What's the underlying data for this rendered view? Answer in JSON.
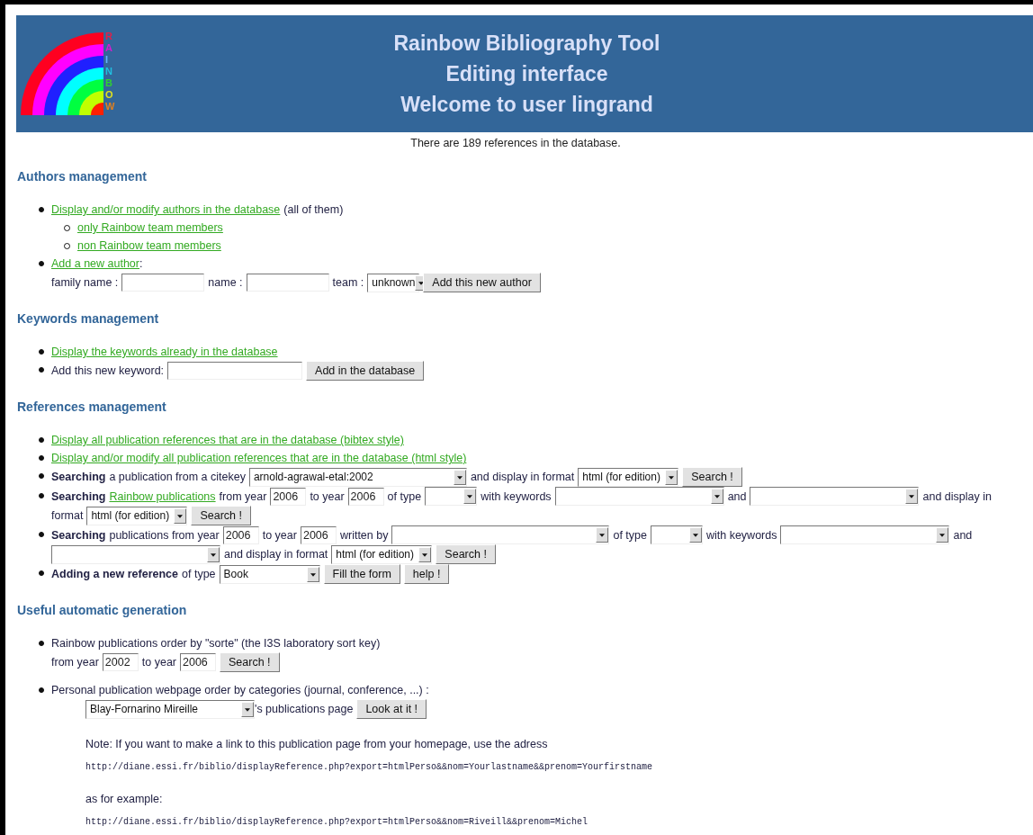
{
  "header": {
    "logo_letters": [
      {
        "text": "R",
        "color": "#e0204a"
      },
      {
        "text": "A",
        "color": "#d020d0"
      },
      {
        "text": "I",
        "color": "#66b3ff"
      },
      {
        "text": "N",
        "color": "#20c0e0"
      },
      {
        "text": "B",
        "color": "#30d030"
      },
      {
        "text": "O",
        "color": "#e0e020"
      },
      {
        "text": "W",
        "color": "#e08020"
      }
    ],
    "titles": [
      "Rainbow Bibliography Tool",
      "Editing interface",
      "Welcome to user lingrand"
    ]
  },
  "count_note": "There are 189 references in the database.",
  "sections": [
    {
      "title": "Authors management",
      "items": [
        {
          "parts": [
            {
              "kind": "link",
              "text": "Display and/or modify authors in the database"
            },
            {
              "kind": "text",
              "text": "(all of them)"
            }
          ],
          "children": [
            {
              "parts": [
                {
                  "kind": "link",
                  "text": "only Rainbow team members"
                }
              ]
            },
            {
              "parts": [
                {
                  "kind": "link",
                  "text": "non Rainbow team members"
                }
              ]
            }
          ]
        },
        {
          "parts": [
            {
              "kind": "link",
              "text": "Add a new author"
            },
            {
              "kind": "suffix",
              "text": ":"
            },
            {
              "kind": "break"
            },
            {
              "kind": "text",
              "text": "family name :"
            },
            {
              "kind": "namefield"
            },
            {
              "kind": "text",
              "text": "name :"
            },
            {
              "kind": "namefield"
            },
            {
              "kind": "text",
              "text": "team :"
            },
            {
              "kind": "typeselect",
              "value": "unknown"
            },
            {
              "kind": "button",
              "text": "Add this new author"
            }
          ]
        }
      ]
    },
    {
      "title": "Keywords management",
      "items": [
        {
          "parts": [
            {
              "kind": "link",
              "text": "Display the keywords already in the database"
            }
          ]
        },
        {
          "parts": [
            {
              "kind": "text",
              "text": "Add this new keyword:"
            },
            {
              "kind": "keywordfield"
            },
            {
              "kind": "button",
              "text": "Add in the database"
            }
          ]
        }
      ]
    },
    {
      "title": "References management",
      "items": [
        {
          "parts": [
            {
              "kind": "link",
              "text": "Display all publication references that are in the database (bibtex style)"
            }
          ]
        },
        {
          "parts": [
            {
              "kind": "link",
              "text": "Display and/or modify all publication references that are in the database (html style)"
            }
          ]
        },
        {
          "parts": [
            {
              "kind": "bold",
              "text": "Searching"
            },
            {
              "kind": "text",
              "text": "a publication from a citekey"
            },
            {
              "kind": "citekeyselect",
              "value": "arnold-agrawal-etal:2002"
            },
            {
              "kind": "text",
              "text": "and display in format"
            },
            {
              "kind": "formatselect",
              "value": "html (for edition)"
            },
            {
              "kind": "button",
              "text": "Search !"
            }
          ]
        },
        {
          "parts": [
            {
              "kind": "bold",
              "text": "Searching"
            },
            {
              "kind": "link",
              "text": "Rainbow publications"
            },
            {
              "kind": "text",
              "text": "from year"
            },
            {
              "kind": "yearfield",
              "value": "2006"
            },
            {
              "kind": "text",
              "text": "to year"
            },
            {
              "kind": "yearfield",
              "value": "2006"
            },
            {
              "kind": "text",
              "text": "of type"
            },
            {
              "kind": "typeselect"
            },
            {
              "kind": "text",
              "text": "with keywords"
            },
            {
              "kind": "keywordselect"
            },
            {
              "kind": "text",
              "text": "and"
            },
            {
              "kind": "keywordselect"
            },
            {
              "kind": "text",
              "text": "and display in"
            },
            {
              "kind": "break"
            },
            {
              "kind": "text",
              "text": "format"
            },
            {
              "kind": "formatselect",
              "value": "html (for edition)"
            },
            {
              "kind": "button",
              "text": "Search !"
            }
          ]
        },
        {
          "parts": [
            {
              "kind": "bold",
              "text": "Searching"
            },
            {
              "kind": "text",
              "text": "publications from year"
            },
            {
              "kind": "yearfield",
              "value": "2006"
            },
            {
              "kind": "text",
              "text": "to year"
            },
            {
              "kind": "yearfield",
              "value": "2006"
            },
            {
              "kind": "text",
              "text": "written by"
            },
            {
              "kind": "citekeyselect"
            },
            {
              "kind": "text",
              "text": "of type"
            },
            {
              "kind": "typeselect"
            },
            {
              "kind": "text",
              "text": "with keywords"
            },
            {
              "kind": "keywordselect"
            },
            {
              "kind": "text",
              "text": "and"
            },
            {
              "kind": "break"
            },
            {
              "kind": "keywordselect"
            },
            {
              "kind": "text",
              "text": "and display in format"
            },
            {
              "kind": "formatselect",
              "value": "html (for edition)"
            },
            {
              "kind": "button",
              "text": "Search !"
            }
          ]
        },
        {
          "parts": [
            {
              "kind": "bold",
              "text": "Adding a new reference"
            },
            {
              "kind": "text",
              "text": "of type"
            },
            {
              "kind": "formatselect",
              "value": "Book"
            },
            {
              "kind": "button",
              "text": "Fill the form"
            },
            {
              "kind": "button",
              "text": "help !"
            }
          ]
        }
      ]
    },
    {
      "title": "Useful automatic generation",
      "items": [
        {
          "parts": [
            {
              "kind": "text",
              "text": "Rainbow publications order by \"sorte\" (the I3S laboratory sort key)"
            },
            {
              "kind": "break"
            },
            {
              "kind": "text",
              "text": "from year"
            },
            {
              "kind": "yearfield",
              "value": "2002"
            },
            {
              "kind": "text",
              "text": "to year"
            },
            {
              "kind": "yearfield",
              "value": "2006"
            },
            {
              "kind": "button",
              "text": "Search !"
            }
          ]
        },
        {
          "parts": [
            {
              "kind": "text",
              "text": "Personal publication webpage order by categories (journal, conference, ...) :"
            }
          ],
          "details": [
            {
              "kind": "form",
              "parts": [
                {
                  "kind": "keywordselect",
                  "value": "Blay-Fornarino Mireille"
                },
                {
                  "kind": "suffix",
                  "text": "'s publications page"
                },
                {
                  "kind": "button",
                  "text": "Look at it !"
                }
              ]
            },
            {
              "kind": "note",
              "text": "Note: If you want to make a link to this publication page from your homepage, use the adress"
            },
            {
              "kind": "code",
              "text": "http://diane.essi.fr/biblio/displayReference.php?export=htmlPerso&&nom=Yourlastname&&prenom=Yourfirstname"
            },
            {
              "kind": "note",
              "text": "as for example:"
            },
            {
              "kind": "code",
              "text": "http://diane.essi.fr/biblio/displayReference.php?export=htmlPerso&&nom=Riveill&&prenom=Michel"
            }
          ]
        }
      ]
    }
  ]
}
